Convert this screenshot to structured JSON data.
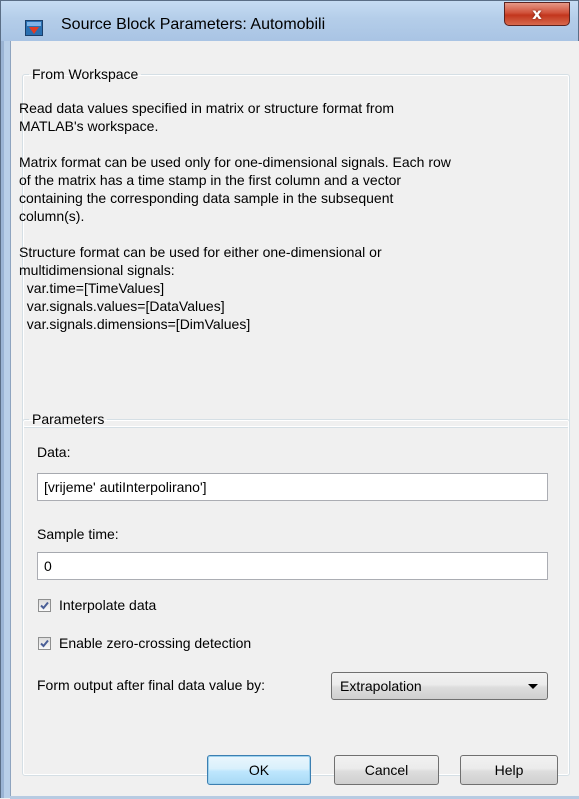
{
  "window": {
    "title": "Source Block Parameters: Automobili",
    "close_symbol": "x",
    "icon": "simulink-block-icon"
  },
  "workspace_group": {
    "legend": "From Workspace",
    "description": "Read data values specified in matrix or structure format from\nMATLAB's workspace.\n\nMatrix format can be used only for one-dimensional signals. Each row\nof the matrix has a time stamp in the first column and a vector\ncontaining the corresponding data sample in the subsequent\ncolumn(s).\n\nStructure format can be used for either one-dimensional or\nmultidimensional signals:\n  var.time=[TimeValues]\n  var.signals.values=[DataValues]\n  var.signals.dimensions=[DimValues]"
  },
  "parameters": {
    "legend": "Parameters",
    "data_label": "Data:",
    "data_value": "[vrijeme' autiInterpolirano']",
    "sample_time_label": "Sample time:",
    "sample_time_value": "0",
    "interpolate_label": "Interpolate data",
    "interpolate_checked": true,
    "zero_crossing_label": "Enable zero-crossing detection",
    "zero_crossing_checked": true,
    "form_output_label": "Form output after final data value by:",
    "form_output_selected": "Extrapolation"
  },
  "buttons": {
    "ok": "OK",
    "cancel": "Cancel",
    "help": "Help"
  },
  "colors": {
    "default_button_border": "#3c7fb1",
    "close_button": "#c2361d",
    "checkmark": "#4a5f97"
  }
}
